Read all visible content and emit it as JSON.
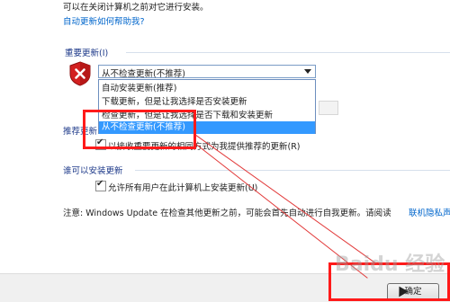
{
  "header": {
    "intro_text": "可以在关闭计算机之前对它进行安装。",
    "help_link": "自动更新如何帮助我?"
  },
  "important_updates": {
    "section_title": "重要更新(I)",
    "selected_value": "从不检查更新(不推荐)",
    "dropdown_options": [
      "自动安装更新(推荐)",
      "下载更新，但是让我选择是否安装更新",
      "检查更新，但是让我选择是否下载和安装更新",
      "从不检查更新(不推荐)"
    ]
  },
  "recommended_updates": {
    "section_title": "推荐更新",
    "checkbox_label": "以接收重要更新的相同方式为我提供推荐的更新(R)",
    "checked": true
  },
  "who_can_install": {
    "section_title": "谁可以安装更新",
    "checkbox_label": "允许所有用户在此计算机上安装更新(U)",
    "checked": true
  },
  "note": {
    "text": "注意: Windows Update 在检查其他更新之前，可能会首先自动进行自我更新。请阅读",
    "link": "联机隐私声"
  },
  "footer": {
    "ok_label": "确定"
  },
  "watermark": {
    "text": "Baidu 经验"
  },
  "colors": {
    "annotation_red": "#ff1a1a",
    "selection_blue": "#3399ff",
    "link_blue": "#0066cc",
    "section_title_blue": "#1e3a8a"
  },
  "icons": {
    "shield": "shield-error-icon",
    "dropdown_arrow": "chevron-down-icon",
    "checkmark": "check-icon",
    "cursor": "cursor-icon"
  }
}
